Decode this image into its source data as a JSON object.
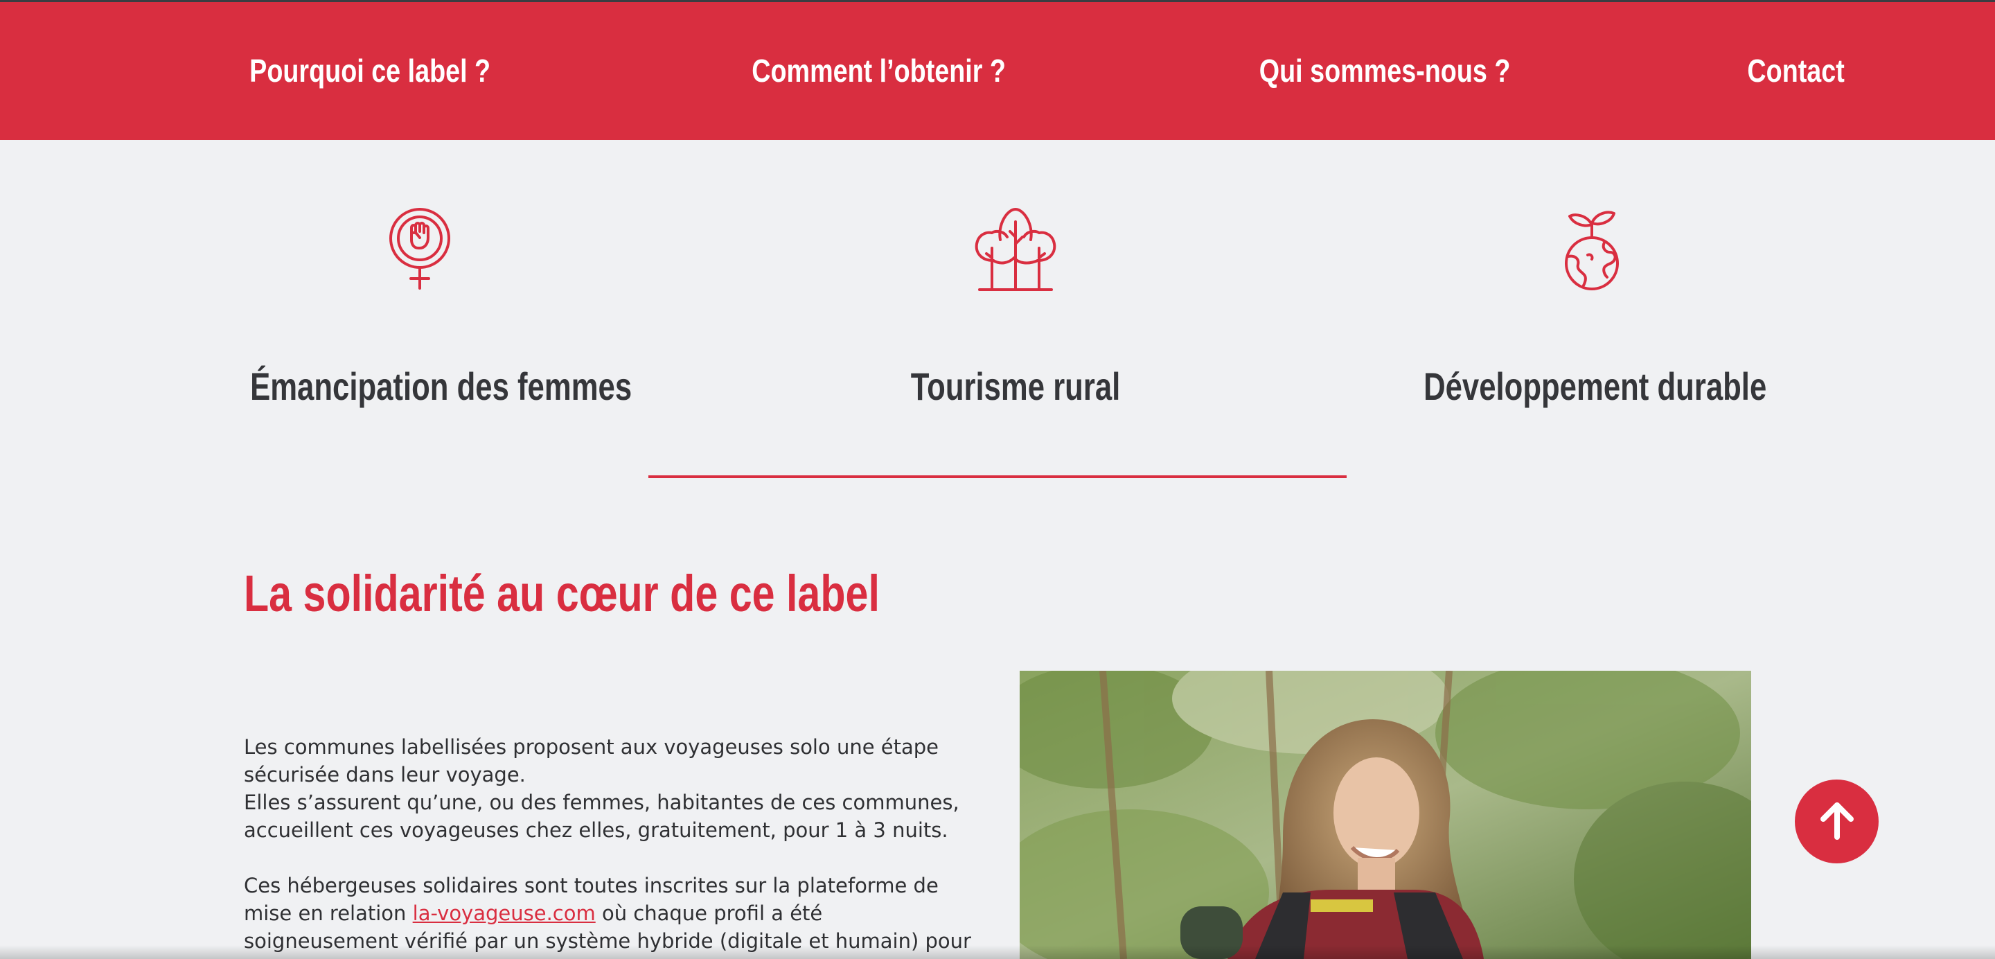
{
  "nav": {
    "items": [
      {
        "label": "Pourquoi ce label ?"
      },
      {
        "label": "Comment l’obtenir ?"
      },
      {
        "label": "Qui sommes-nous ?"
      },
      {
        "label": "Contact"
      }
    ]
  },
  "features": [
    {
      "title": "Émancipation des femmes",
      "icon": "feminist-fist-icon"
    },
    {
      "title": "Tourisme rural",
      "icon": "trees-icon"
    },
    {
      "title": "Développement durable",
      "icon": "globe-sprout-icon"
    }
  ],
  "section": {
    "title": "La solidarité au cœur de ce label",
    "para1_line1": "Les communes labellisées proposent aux voyageuses solo une étape sécurisée dans leur voyage.",
    "para1_line2": "Elles s’assurent qu’une, ou des femmes, habitantes de ces communes, accueillent ces voyageuses chez elles, gratuitement, pour 1 à 3 nuits.",
    "para2_before": "Ces hébergeuses solidaires sont toutes inscrites sur la plateforme de mise en relation ",
    "para2_link": "la-voyageuse.com",
    "para2_after": " où chaque profil a été soigneusement vérifié par un système hybride (digitale et humain) pour permettre de voyager sereinement."
  },
  "colors": {
    "accent": "#d92e40",
    "background": "#f0f1f3",
    "text": "#2f3033"
  },
  "back_to_top_icon": "arrow-up-icon"
}
